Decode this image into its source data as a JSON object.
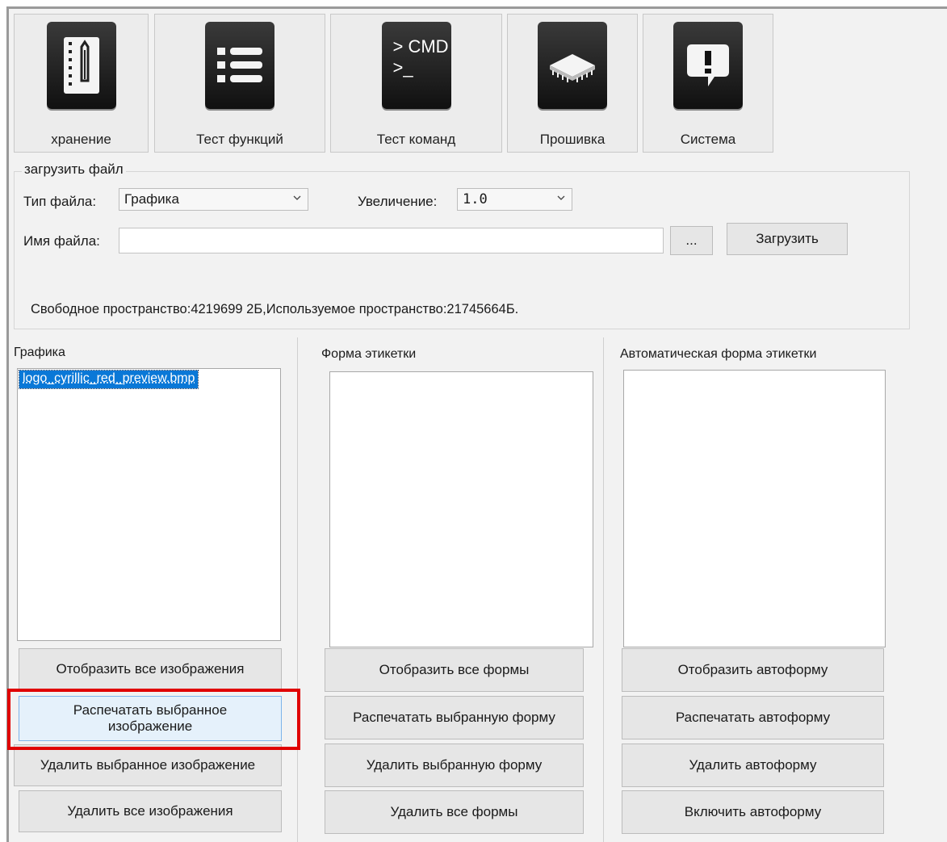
{
  "toolbar": {
    "items": [
      {
        "label": "хранение",
        "icon": "notebook-pencil-icon"
      },
      {
        "label": "Тест функций",
        "icon": "list-icon"
      },
      {
        "label": "Тест команд",
        "icon": "cmd-terminal-icon",
        "icon_text_1": "> CMD",
        "icon_text_2": ">_"
      },
      {
        "label": "Прошивка",
        "icon": "chip-icon"
      },
      {
        "label": "Система",
        "icon": "exclamation-bubble-icon"
      }
    ]
  },
  "upload_group": {
    "title": "загрузить файл",
    "file_type_label": "Тип файла:",
    "file_type_value": "Графика",
    "zoom_label": "Увеличение:",
    "zoom_value": "1.0",
    "file_name_label": "Имя файла:",
    "file_name_value": "",
    "browse_label": "...",
    "upload_label": "Загрузить",
    "space_info": "Свободное пространство:4219699 2Б,Используемое пространство:21745664Б."
  },
  "graphics_panel": {
    "title": "Графика",
    "items": [
      "logo_cyrillic_red_preview.bmp"
    ],
    "buttons": {
      "show_all": "Отобразить все изображения",
      "print_selected": "Распечатать выбранное изображение",
      "delete_selected": "Удалить выбранное изображение",
      "delete_all": "Удалить все изображения"
    }
  },
  "label_form_panel": {
    "title": "Форма этикетки",
    "buttons": {
      "show_all": "Отобразить все формы",
      "print_selected": "Распечатать выбранную форму",
      "delete_selected": "Удалить выбранную форму",
      "delete_all": "Удалить все формы"
    }
  },
  "auto_form_panel": {
    "title": "Автоматическая форма этикетки",
    "buttons": {
      "show": "Отобразить автоформу",
      "print": "Распечатать автоформу",
      "delete": "Удалить автоформу",
      "enable": "Включить автоформу"
    }
  },
  "colors": {
    "selection": "#0a78d7",
    "highlight": "#e00000",
    "button_face": "#e6e6e6",
    "hover_button": "#e5f1fb"
  }
}
